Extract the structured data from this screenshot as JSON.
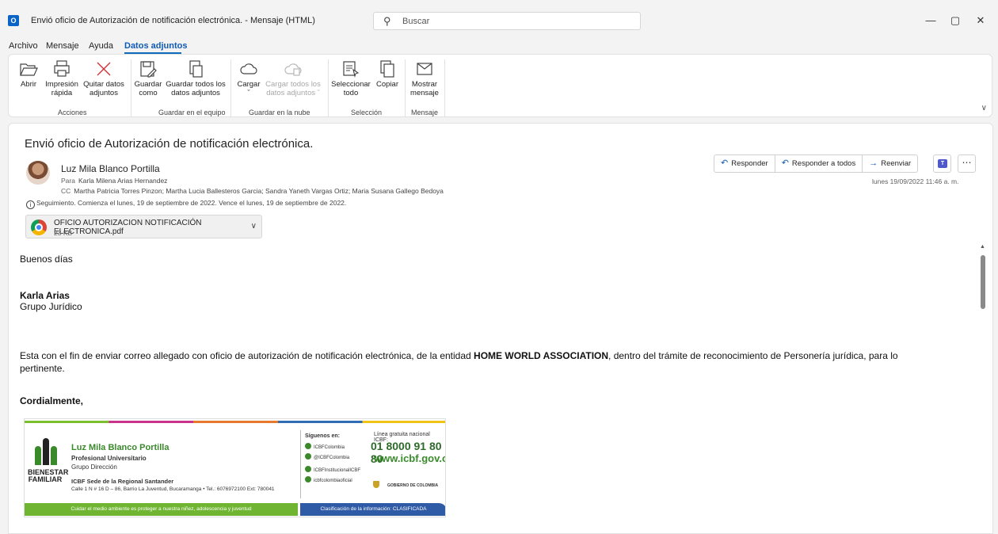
{
  "window": {
    "app_icon": "outlook-icon",
    "title": "Envió oficio de Autorización de notificación electrónica.  -  Mensaje (HTML)",
    "search_placeholder": "Buscar",
    "minimize": "—",
    "restore": "▢",
    "close": "✕"
  },
  "menu": [
    "Archivo",
    "Mensaje",
    "Ayuda",
    "Datos adjuntos"
  ],
  "ribbon": {
    "groups": [
      "Acciones",
      "Guardar en el equipo",
      "Guardar en la nube",
      "Selección",
      "Mensaje"
    ],
    "buttons": {
      "abrir": "Abrir",
      "impresion_1": "Impresión",
      "impresion_2": "rápida",
      "quitar_1": "Quitar datos",
      "quitar_2": "adjuntos",
      "guardar_como_1": "Guardar",
      "guardar_como_2": "como",
      "guardar_todos_1": "Guardar todos los",
      "guardar_todos_2": "datos adjuntos",
      "cargar_1": "Cargar",
      "cargar_2": "ˇ",
      "cargar_todos_1": "Cargar todos los",
      "cargar_todos_2": "datos adjuntos ˇ",
      "seleccionar_1": "Seleccionar",
      "seleccionar_2": "todo",
      "copiar": "Copiar",
      "mostrar_1": "Mostrar",
      "mostrar_2": "mensaje"
    }
  },
  "message": {
    "subject": "Envió oficio de Autorización de notificación electrónica.",
    "sender": "Luz Mila Blanco Portilla",
    "to_label": "Para",
    "to": "Karla Milena Arias Hernandez",
    "cc_label": "CC",
    "cc": "Martha Patricia Torres Pinzon; Martha Lucia Ballesteros Garcia; Sandra Yaneth Vargas Ortiz; Maria Susana Gallego Bedoya",
    "followup": "Seguimiento.  Comienza el lunes, 19 de septiembre de 2022.  Vence el lunes, 19 de septiembre de 2022.",
    "datetime": "lunes 19/09/2022 11:46 a. m.",
    "actions": {
      "reply": "Responder",
      "reply_all": "Responder a todos",
      "forward": "Reenviar"
    },
    "attachment": {
      "name": "OFICIO AUTORIZACION NOTIFICACIÓN ELECTRONICA.pdf",
      "size": "23 KB"
    }
  },
  "body": {
    "greeting": "Buenos días",
    "name": "Karla Arias",
    "group": "Grupo Jurídico",
    "para_1_a": "Esta con el fin de enviar correo allegado con oficio de autorización de notificación electrónica, de la entidad ",
    "para_1_bold": "HOME WORLD ASSOCIATION",
    "para_1_b": ", dentro del trámite de reconocimiento de Personería jurídica, para lo",
    "para_1_c": "pertinente.",
    "closing": "Cordialmente,"
  },
  "signature": {
    "org_1": "BIENESTAR",
    "org_2": "FAMILIAR",
    "name": "Luz Mila Blanco Portilla",
    "role": "Profesional Universitario",
    "group": "Grupo Dirección",
    "sede": "ICBF Sede de la Regional Santander",
    "address": "Calle 1 N # 16 D – 86, Barrio La Juventud, Bucaramanga • Tel.: 6076972100   Ext: 780041",
    "siguenos": "Síguenos en:",
    "social": [
      "ICBFColombia",
      "@ICBFColombia",
      "ICBFInstitucionalICBF",
      "icbfcolombiaoficial"
    ],
    "linea": "Línea gratuita nacional ICBF:",
    "phone": "01 8000 91 80 80",
    "web": "www.icbf.gov.co",
    "gobierno": "GOBIERNO DE COLOMBIA",
    "footer_left": "Cuidar el medio ambiente es proteger a nuestra niñez, adolescencia y juventud",
    "footer_right": "Clasificación de la información: CLASIFICADA"
  }
}
